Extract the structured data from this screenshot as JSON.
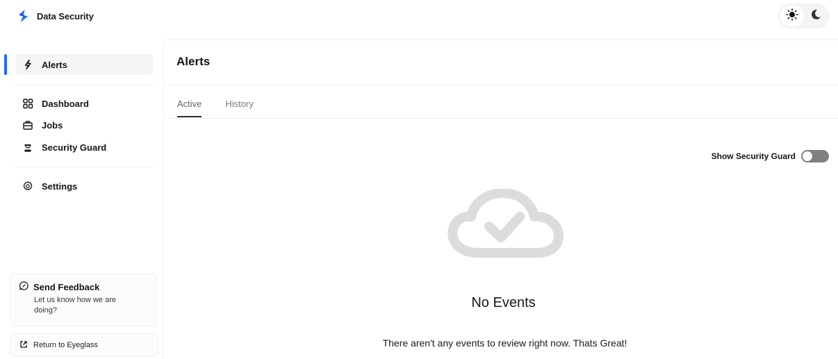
{
  "app": {
    "name": "Data Security",
    "brand_color": "#1f6bff"
  },
  "theme": {
    "light_icon": "sun-icon",
    "dark_icon": "moon-icon",
    "selected": "light"
  },
  "sidebar": {
    "active_item": "Alerts",
    "items": [
      {
        "label": "Alerts",
        "icon": "lightning-icon"
      },
      {
        "label": "Dashboard",
        "icon": "grid-icon"
      },
      {
        "label": "Jobs",
        "icon": "briefcase-icon"
      },
      {
        "label": "Security Guard",
        "icon": "guard-icon"
      },
      {
        "label": "Settings",
        "icon": "gear-icon"
      }
    ],
    "feedback": {
      "title": "Send Feedback",
      "subtitle": "Let us know how we are doing?",
      "icon": "chat-icon"
    },
    "return_link": {
      "label": "Return to Eyeglass",
      "icon": "external-link-icon"
    }
  },
  "main": {
    "title": "Alerts",
    "tabs": [
      {
        "label": "Active",
        "active": true
      },
      {
        "label": "History",
        "active": false
      }
    ],
    "toggle": {
      "label": "Show Security Guard",
      "on": false
    },
    "empty_state": {
      "icon": "cloud-check-icon",
      "title": "No Events",
      "message": "There aren't any events to review right now. Thats Great!"
    }
  }
}
